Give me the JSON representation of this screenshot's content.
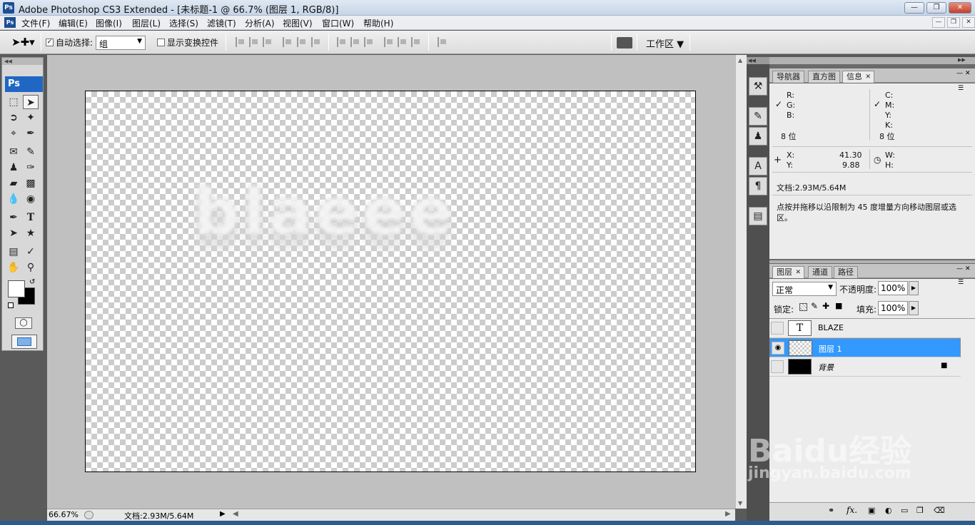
{
  "window": {
    "title": "Adobe Photoshop CS3 Extended - [未标题-1 @ 66.7% (图层 1, RGB/8)]",
    "app_icon": "Ps"
  },
  "menu": [
    "文件(F)",
    "编辑(E)",
    "图像(I)",
    "图层(L)",
    "选择(S)",
    "滤镜(T)",
    "分析(A)",
    "视图(V)",
    "窗口(W)",
    "帮助(H)"
  ],
  "options": {
    "auto_select_label": "自动选择:",
    "auto_select_value": "组",
    "show_transform_label": "显示变换控件",
    "workspace_label": "工作区"
  },
  "toolbox": {
    "logo": "Ps"
  },
  "canvas": {
    "text": "blaeee"
  },
  "status": {
    "zoom": "66.67%",
    "doc_info": "文档:2.93M/5.64M"
  },
  "panel_tabs_top": [
    "导航器",
    "直方图",
    "信息"
  ],
  "info": {
    "r_label": "R:",
    "g_label": "G:",
    "b_label": "B:",
    "c_label": "C:",
    "m_label": "M:",
    "y_label": "Y:",
    "k_label": "K:",
    "bits_left": "8 位",
    "bits_right": "8 位",
    "x_label": "X:",
    "x_value": "41.30",
    "y2_label": "Y:",
    "y_value": "9.88",
    "w_label": "W:",
    "h_label": "H:",
    "doc": "文档:2.93M/5.64M",
    "hint": "点按并拖移以沿限制为 45 度增量方向移动图层或选区。"
  },
  "layers_tabs": [
    "图层",
    "通道",
    "路径"
  ],
  "layers": {
    "blend_mode": "正常",
    "opacity_label": "不透明度:",
    "opacity_value": "100%",
    "lock_label": "锁定:",
    "fill_label": "填充:",
    "fill_value": "100%",
    "items": [
      {
        "name": "BLAZE",
        "thumb_label": "T"
      },
      {
        "name": "图层 1"
      },
      {
        "name": "背景"
      }
    ]
  },
  "watermark": {
    "brand": "Baidu经验",
    "url": "jingyan.baidu.com"
  }
}
